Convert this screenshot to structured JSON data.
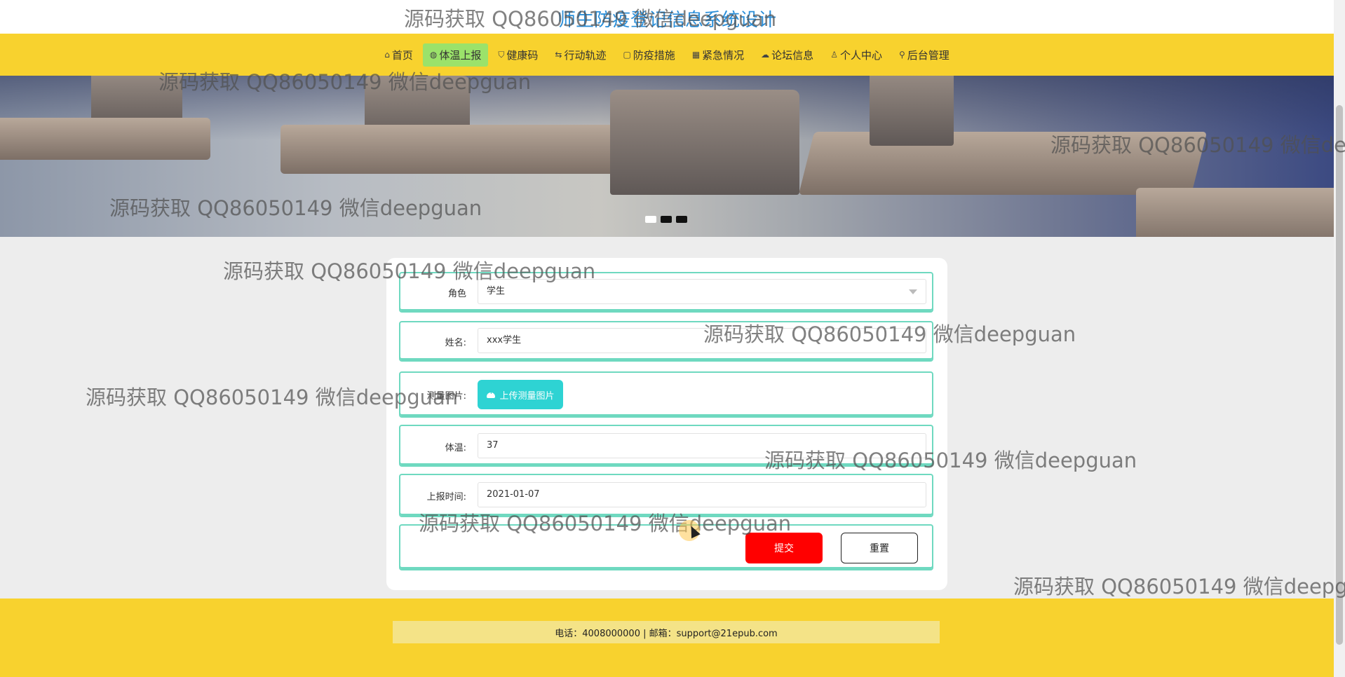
{
  "site": {
    "title": "师生防疫登记信息系统设计"
  },
  "nav": {
    "items": [
      {
        "label": "首页",
        "icon": "home-icon",
        "glyph": "⌂"
      },
      {
        "label": "体温上报",
        "icon": "globe-icon",
        "glyph": "◍"
      },
      {
        "label": "健康码",
        "icon": "shield-icon",
        "glyph": "⛉"
      },
      {
        "label": "行动轨迹",
        "icon": "sliders-icon",
        "glyph": "⇆"
      },
      {
        "label": "防疫措施",
        "icon": "clipboard-icon",
        "glyph": "▢"
      },
      {
        "label": "紧急情况",
        "icon": "grid-icon",
        "glyph": "▦"
      },
      {
        "label": "论坛信息",
        "icon": "cloud-icon",
        "glyph": "☁"
      },
      {
        "label": "个人中心",
        "icon": "user-icon",
        "glyph": "♙"
      },
      {
        "label": "后台管理",
        "icon": "link-icon",
        "glyph": "⚲"
      }
    ]
  },
  "form": {
    "role": {
      "label": "角色",
      "value": "学生"
    },
    "name": {
      "label": "姓名:",
      "value": "xxx学生"
    },
    "photo": {
      "label": "测量图片:",
      "button": "上传测量图片"
    },
    "temperature": {
      "label": "体温:",
      "value": "37"
    },
    "report_time": {
      "label": "上报时间:",
      "value": "2021-01-07"
    },
    "submit_label": "提交",
    "reset_label": "重置"
  },
  "footer": {
    "contact": "电话：4008000000 | 邮箱：support@21epub.com"
  },
  "watermark": "源码获取 QQ86050149 微信deepguan"
}
